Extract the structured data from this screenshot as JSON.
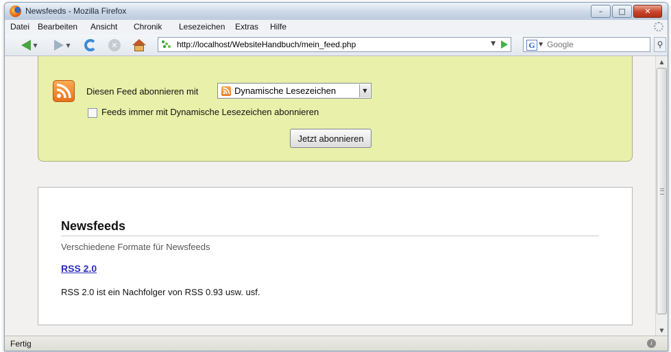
{
  "window": {
    "title": "Newsfeeds - Mozilla Firefox",
    "minimize": "–",
    "maximize": "□",
    "close": "✕"
  },
  "menubar": {
    "items": [
      "Datei",
      "Bearbeiten",
      "Ansicht",
      "Chronik",
      "Lesezeichen",
      "Extras",
      "Hilfe"
    ]
  },
  "navbar": {
    "icons": [
      "back-arrow-icon",
      "forward-arrow-icon",
      "reload-icon",
      "stop-icon",
      "home-icon"
    ],
    "url": "http://localhost/WebsiteHandbuch/mein_feed.php",
    "search": {
      "engine": "G",
      "placeholder": "Google"
    }
  },
  "feed_box": {
    "subscribe_label": "Diesen Feed abonnieren mit",
    "reader_option": "Dynamische Lesezeichen",
    "always_label": "Feeds immer mit Dynamische Lesezeichen abonnieren",
    "always_checked": false,
    "subscribe_button": "Jetzt abonnieren"
  },
  "article": {
    "title": "Newsfeeds",
    "subtitle": "Verschiedene Formate für Newsfeeds",
    "entry_title": "RSS 2.0",
    "entry_text": "RSS 2.0 ist ein Nachfolger von RSS 0.93 usw. usf."
  },
  "statusbar": {
    "text": "Fertig"
  },
  "colors": {
    "feed_box_bg": "#e8f0a9",
    "rss_orange": "#f08a24",
    "link": "#2b2bc2"
  }
}
